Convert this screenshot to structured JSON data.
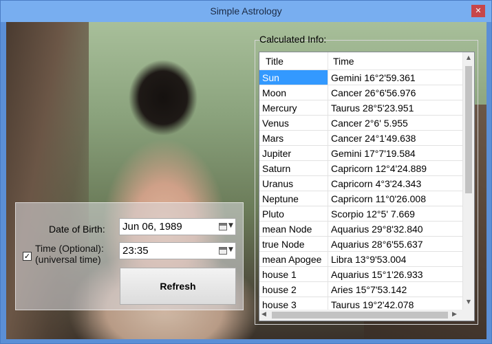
{
  "window": {
    "title": "Simple Astrology",
    "close_glyph": "✕"
  },
  "form": {
    "dob_label": "Date of Birth:",
    "dob_value": "Jun  06, 1989",
    "time_label_line1": "Time (Optional):",
    "time_label_line2": "(universal time)",
    "time_checked": true,
    "time_value": "23:35",
    "refresh_label": "Refresh",
    "calendar_icon": "calendar-icon",
    "dropdown_glyph": "▼"
  },
  "info": {
    "group_label": "Calculated Info:",
    "columns": [
      "Title",
      "Time"
    ],
    "rows": [
      {
        "title": "Sun",
        "time": "Gemini 16°2'59.361",
        "selected": true
      },
      {
        "title": "Moon",
        "time": "Cancer 26°6'56.976"
      },
      {
        "title": "Mercury",
        "time": "Taurus 28°5'23.951"
      },
      {
        "title": "Venus",
        "time": "Cancer 2°6' 5.955"
      },
      {
        "title": "Mars",
        "time": "Cancer 24°1'49.638"
      },
      {
        "title": "Jupiter",
        "time": "Gemini 17°7'19.584"
      },
      {
        "title": "Saturn",
        "time": "Capricorn 12°4'24.889"
      },
      {
        "title": "Uranus",
        "time": "Capricorn 4°3'24.343"
      },
      {
        "title": "Neptune",
        "time": "Capricorn 11°0'26.008"
      },
      {
        "title": "Pluto",
        "time": "Scorpio 12°5' 7.669"
      },
      {
        "title": "mean Node",
        "time": "Aquarius 29°8'32.840"
      },
      {
        "title": "true Node",
        "time": "Aquarius 28°6'55.637"
      },
      {
        "title": "mean Apogee",
        "time": "Libra 13°9'53.004"
      },
      {
        "title": "house  1",
        "time": "Aquarius 15°1'26.933"
      },
      {
        "title": "house  2",
        "time": "Aries 15°7'53.142"
      },
      {
        "title": "house  3",
        "time": "Taurus 19°2'42.078"
      }
    ]
  },
  "scrollbars": {
    "up": "▲",
    "down": "▼",
    "left": "◀",
    "right": "▶"
  }
}
